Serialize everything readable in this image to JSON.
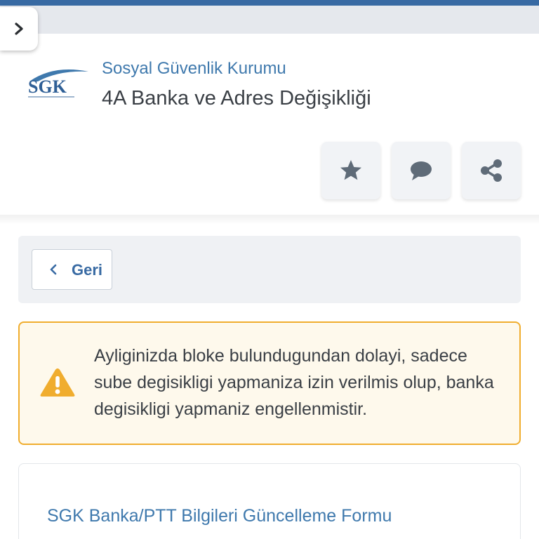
{
  "header": {
    "org_name": "Sosyal Güvenlik Kurumu",
    "service_title": "4A Banka ve Adres Değişikliği",
    "logo_text": "SGK"
  },
  "actions": {
    "favorite_icon": "star-icon",
    "comment_icon": "speech-bubble-icon",
    "share_icon": "share-icon"
  },
  "navigation": {
    "back_label": "Geri"
  },
  "warning": {
    "message": "Ayliginizda bloke bulundugundan dolayi, sadece sube degisikligi yapmaniza izin verilmis olup, banka degisikligi yapmaniz engellenmistir.",
    "accent_color": "#f0ad2e"
  },
  "form": {
    "title": "SGK Banka/PTT Bilgileri Güncelleme Formu"
  },
  "colors": {
    "brand_blue": "#386aa3",
    "link_blue": "#3f79ad",
    "warning_background": "#fef9ec"
  }
}
